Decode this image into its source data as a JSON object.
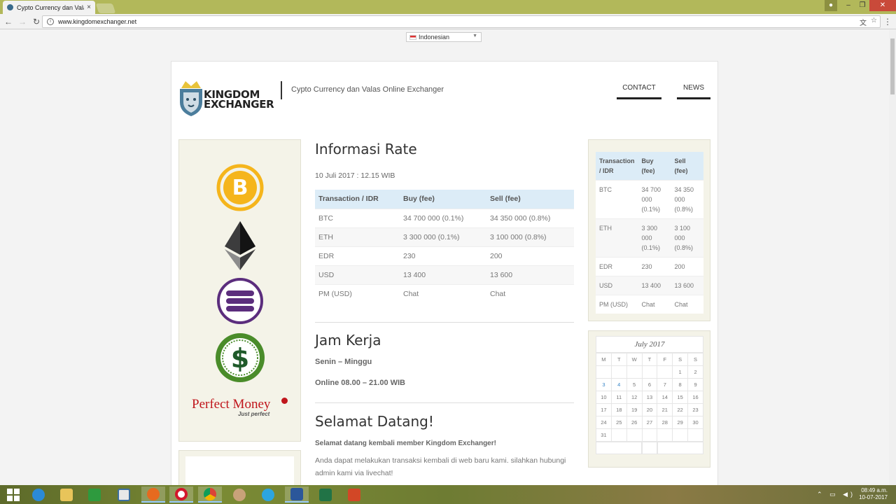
{
  "browser": {
    "tab_title": "Cypto Currency dan Vala",
    "url": "www.kingdomexchanger.net",
    "tab_close": "×",
    "back": "←",
    "forward": "→",
    "reload": "↻",
    "translate_icon": "文",
    "star_icon": "☆",
    "menu_icon": "⋮",
    "info_icon": "i",
    "win_min": "–",
    "win_max": "❐",
    "win_close": "✕"
  },
  "language_select": {
    "value": "Indonesian"
  },
  "header": {
    "logo_line1": "KINGDOM",
    "logo_line2": "EXCHANGER",
    "tagline": "Cypto Currency dan Valas Online Exchanger",
    "nav": [
      {
        "label": "CONTACT"
      },
      {
        "label": "NEWS"
      }
    ]
  },
  "left_panel": {
    "icons": [
      "bitcoin-icon",
      "ethereum-icon",
      "edr-icon",
      "dollar-icon",
      "perfect-money-logo"
    ],
    "pm_text": "Perfect Money",
    "pm_tagline": "Just perfect"
  },
  "main": {
    "rate_title": "Informasi Rate",
    "rate_date": "10 Juli 2017 : 12.15 WIB",
    "table": {
      "headers": [
        "Transaction / IDR",
        "Buy (fee)",
        "Sell (fee)"
      ],
      "rows": [
        [
          "BTC",
          "34 700 000 (0.1%)",
          "34 350 000 (0.8%)"
        ],
        [
          "ETH",
          "3 300 000 (0.1%)",
          "3 100 000 (0.8%)"
        ],
        [
          "EDR",
          "230",
          "200"
        ],
        [
          "USD",
          "13 400",
          "13 600"
        ],
        [
          "PM (USD)",
          "Chat",
          "Chat"
        ]
      ]
    },
    "hours_title": "Jam Kerja",
    "hours_days": "Senin – Minggu",
    "hours_time": "Online 08.00 – 21.00 WIB",
    "welcome_title": "Selamat Datang!",
    "welcome_bold": "Selamat datang kembali member Kingdom Exchanger!",
    "welcome_text": "Anda dapat melakukan transaksi kembali di web baru kami. silahkan hubungi admin kami via livechat!"
  },
  "side_table": {
    "headers": [
      "Transaction / IDR",
      "Buy (fee)",
      "Sell (fee)"
    ],
    "rows": [
      [
        "BTC",
        "34 700 000 (0.1%)",
        "34 350 000 (0.8%)"
      ],
      [
        "ETH",
        "3 300 000 (0.1%)",
        "3 100 000 (0.8%)"
      ],
      [
        "EDR",
        "230",
        "200"
      ],
      [
        "USD",
        "13 400",
        "13 600"
      ],
      [
        "PM (USD)",
        "Chat",
        "Chat"
      ]
    ]
  },
  "calendar": {
    "title": "July 2017",
    "weekdays": [
      "M",
      "T",
      "W",
      "T",
      "F",
      "S",
      "S"
    ],
    "weeks": [
      [
        "",
        "",
        "",
        "",
        "",
        "1",
        "2"
      ],
      [
        "3",
        "4",
        "5",
        "6",
        "7",
        "8",
        "9"
      ],
      [
        "10",
        "11",
        "12",
        "13",
        "14",
        "15",
        "16"
      ],
      [
        "17",
        "18",
        "19",
        "20",
        "21",
        "22",
        "23"
      ],
      [
        "24",
        "25",
        "26",
        "27",
        "28",
        "29",
        "30"
      ],
      [
        "31",
        "",
        "",
        "",
        "",
        "",
        ""
      ]
    ],
    "linked_days": [
      "3",
      "4"
    ]
  },
  "taskbar": {
    "apps": [
      "start-icon",
      "internet-explorer-icon",
      "file-explorer-icon",
      "store-icon",
      "app-window-icon",
      "firefox-icon",
      "opera-icon",
      "chrome-icon",
      "paint-icon",
      "telegram-icon",
      "word-icon",
      "excel-icon",
      "powerpoint-icon"
    ],
    "time": "08:49 a.m.",
    "date": "10-07-2017",
    "tray_icons": "⌃ ▭ ◀)"
  }
}
